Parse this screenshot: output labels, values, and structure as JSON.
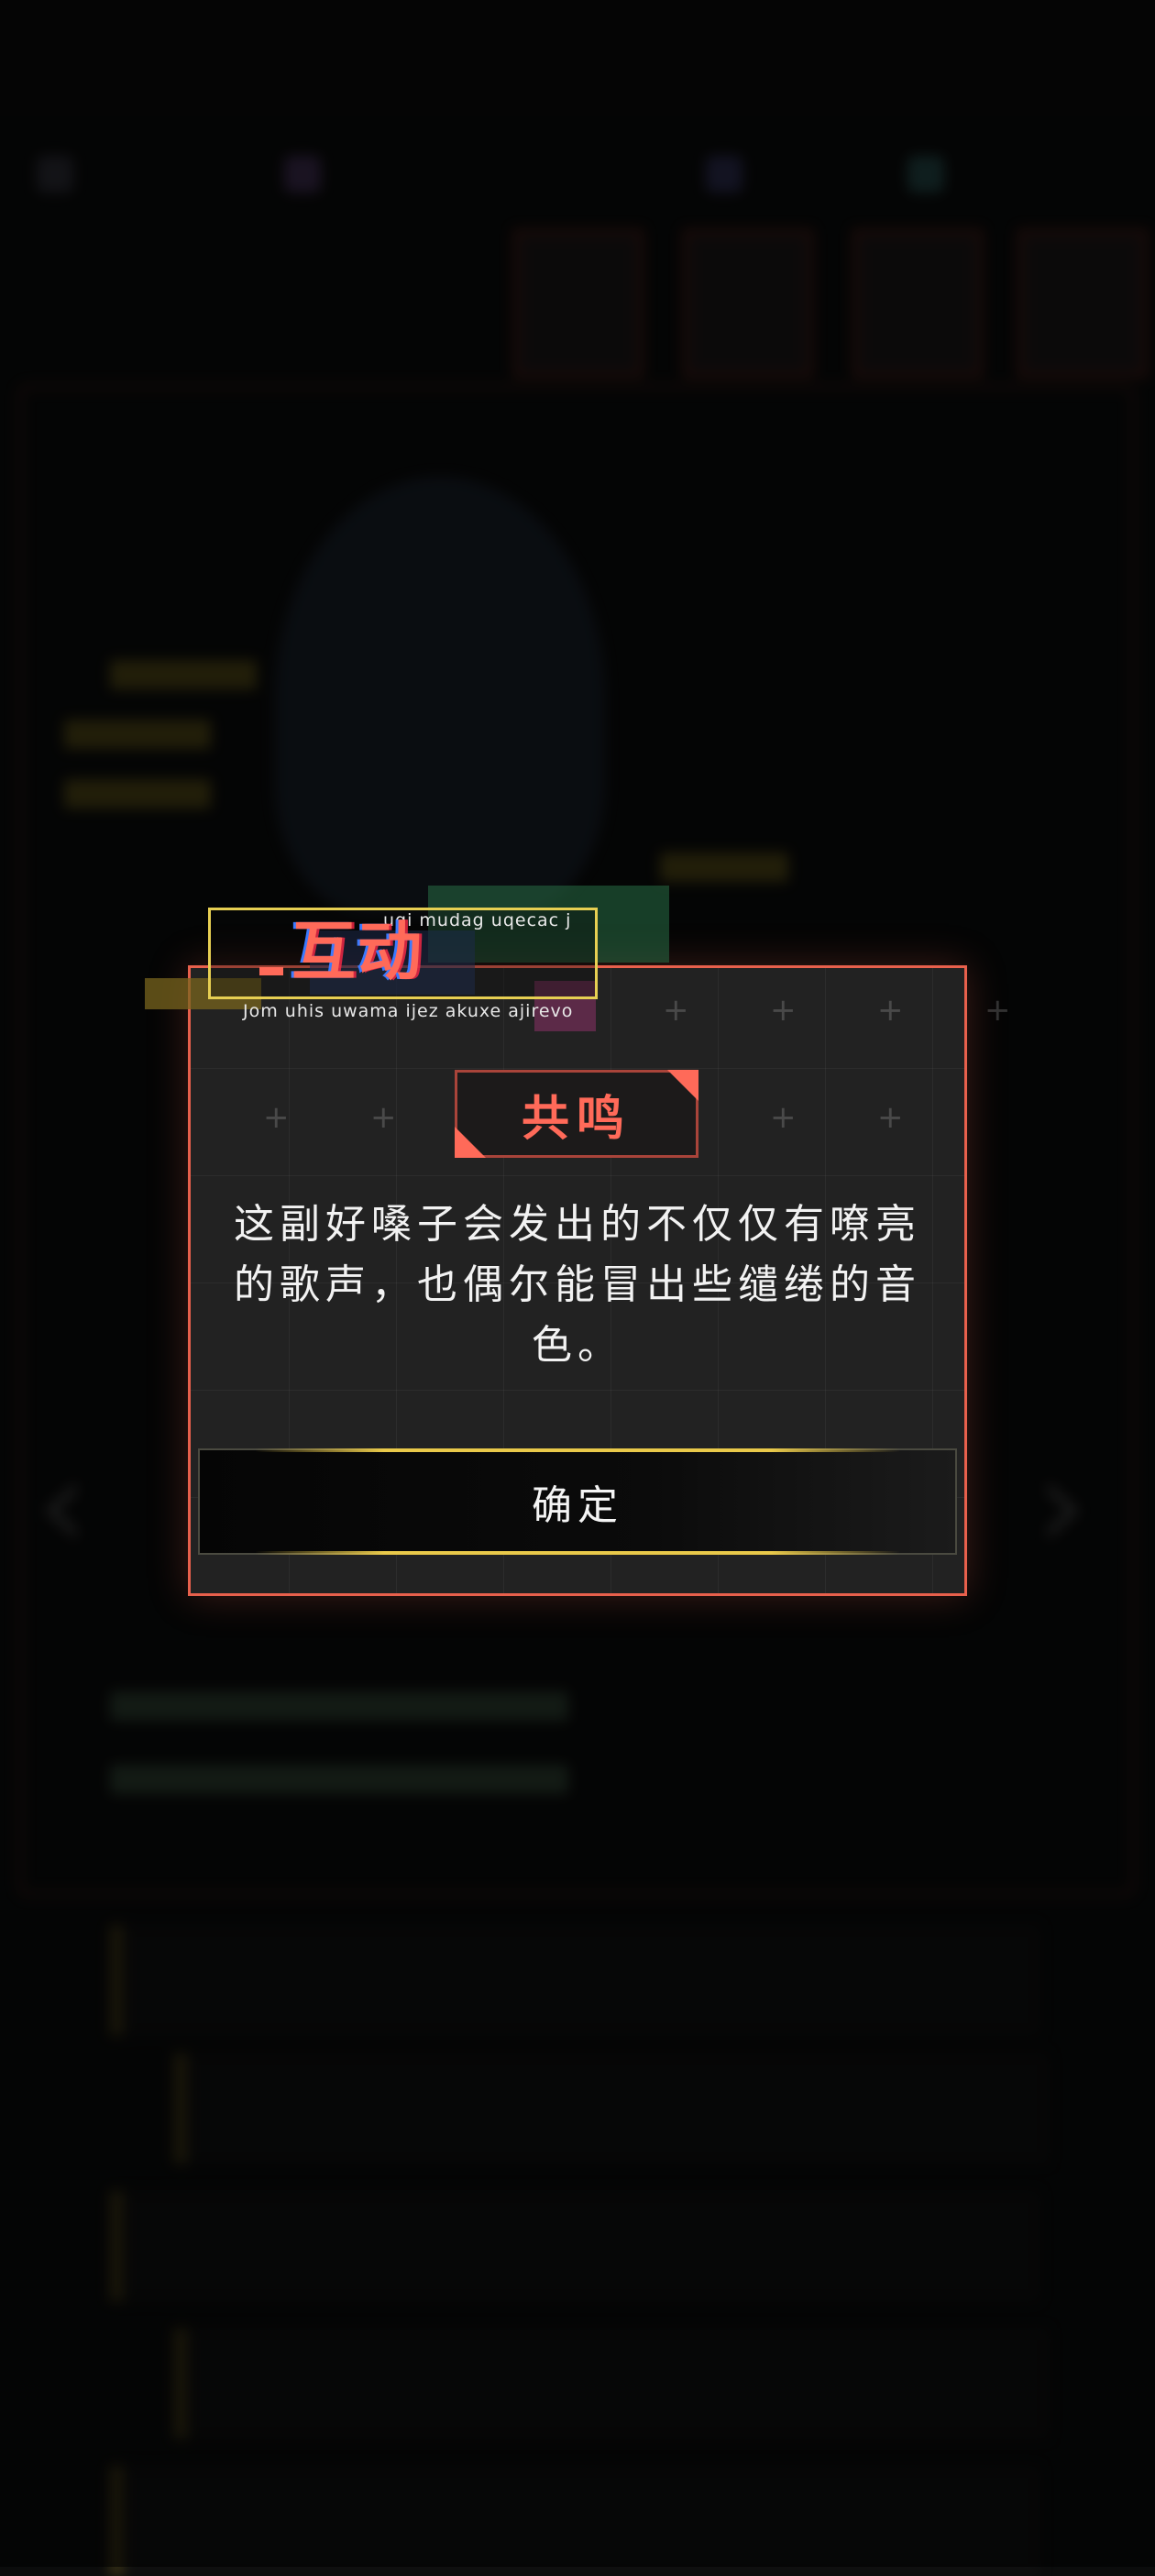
{
  "dialog": {
    "tag_top_text": "uqi mudag uqecac j",
    "tag_title": "互动",
    "tag_bottom_text": "Jom uhis uwama ijez akuxe ajirevo",
    "chip_label": "共鸣",
    "description": "这副好嗓子会发出的不仅仅有嘹亮的歌声，也偶尔能冒出些缱绻的音色。",
    "confirm_label": "确定"
  },
  "icons": {
    "background_left": "chevron-left-icon",
    "background_right": "chevron-right-icon"
  },
  "colors": {
    "accent": "#ff6a59",
    "border": "#e8604c",
    "highlight": "#e7cf52",
    "panel": "#222222"
  }
}
